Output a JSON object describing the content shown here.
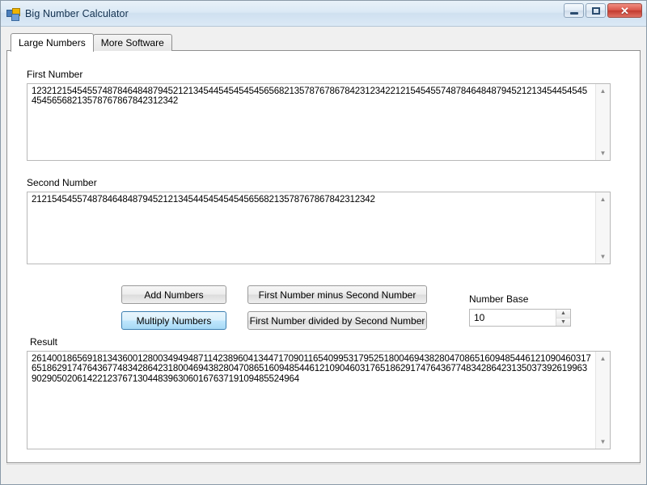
{
  "window": {
    "title": "Big Number Calculator",
    "icon": "app-icon",
    "controls": {
      "minimize": "–",
      "maximize": "□",
      "close": "✕"
    }
  },
  "tabs": [
    {
      "label": "Large Numbers",
      "active": true
    },
    {
      "label": "More Software",
      "active": false
    }
  ],
  "fields": {
    "first_number": {
      "label": "First Number",
      "value": "1232121545455748784648487945212134544545454545656821357876786784231234221215454557487846484879452121345445454545456568213578767867842312342"
    },
    "second_number": {
      "label": "Second Number",
      "value": "21215454557487846484879452121345445454545456568213578767867842312342"
    },
    "result": {
      "label": "Result",
      "value": "2614001865691813436001280034949487114238960413447170901165409953179525180046943828047086516094854461210904603176518629174764367748342864231800469438280470865160948544612109046031765186291747643677483428642313503739261996390290502061422123767130448396306016763719109485524964"
    }
  },
  "buttons": {
    "add": "Add Numbers",
    "multiply": "Multiply Numbers",
    "subtract": "First Number minus Second Number",
    "divide": "First Number divided by Second Number"
  },
  "number_base": {
    "label": "Number Base",
    "value": "10",
    "increment_icon": "spinner-up-icon",
    "decrement_icon": "spinner-down-icon"
  },
  "scrollbars": {
    "up_arrow": "▲",
    "down_arrow": "▼"
  },
  "colors": {
    "titlebar": "#dbe9f5",
    "highlight_button": "#bee6fd",
    "close_button": "#c23b2f",
    "page_background": "#ffffff",
    "dialog_background": "#f0f0f0"
  }
}
